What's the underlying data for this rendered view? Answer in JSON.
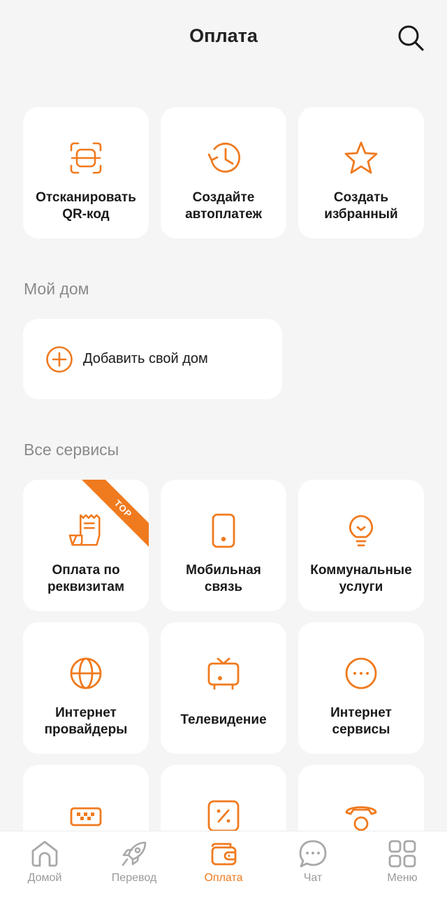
{
  "header": {
    "title": "Оплата"
  },
  "quick_actions": [
    {
      "label_line1": "Отсканировать",
      "label_line2": "QR-код",
      "icon": "qr-scan-icon"
    },
    {
      "label_line1": "Создайте",
      "label_line2": "автоплатеж",
      "icon": "clock-history-icon"
    },
    {
      "label_line1": "Создать",
      "label_line2": "избранный",
      "icon": "star-icon"
    }
  ],
  "my_home": {
    "section_title": "Мой дом",
    "add_label": "Добавить свой дом"
  },
  "services": {
    "section_title": "Все сервисы",
    "top_badge": "TOP",
    "items": [
      {
        "label_line1": "Оплата по",
        "label_line2": "реквизитам",
        "icon": "receipt-icon"
      },
      {
        "label_line1": "Мобильная",
        "label_line2": "связь",
        "icon": "phone-icon"
      },
      {
        "label_line1": "Коммунальные",
        "label_line2": "услуги",
        "icon": "lightbulb-icon"
      },
      {
        "label_line1": "Интернет",
        "label_line2": "провайдеры",
        "icon": "globe-icon"
      },
      {
        "label_line1": "Телевидение",
        "label_line2": "",
        "icon": "tv-icon"
      },
      {
        "label_line1": "Интернет",
        "label_line2": "сервисы",
        "icon": "dots-circle-icon"
      },
      {
        "label_line1": "",
        "label_line2": "",
        "icon": "taxi-icon"
      },
      {
        "label_line1": "",
        "label_line2": "",
        "icon": "percent-icon"
      },
      {
        "label_line1": "",
        "label_line2": "",
        "icon": "landline-phone-icon"
      }
    ]
  },
  "nav": [
    {
      "label": "Домой",
      "icon": "home-icon"
    },
    {
      "label": "Перевод",
      "icon": "rocket-icon"
    },
    {
      "label": "Оплата",
      "icon": "wallet-icon",
      "active": true
    },
    {
      "label": "Чат",
      "icon": "chat-icon"
    },
    {
      "label": "Меню",
      "icon": "grid-icon"
    }
  ],
  "colors": {
    "accent": "#f07a1e",
    "background": "#f5f5f5",
    "card": "#ffffff",
    "muted": "#8a8a8a"
  }
}
